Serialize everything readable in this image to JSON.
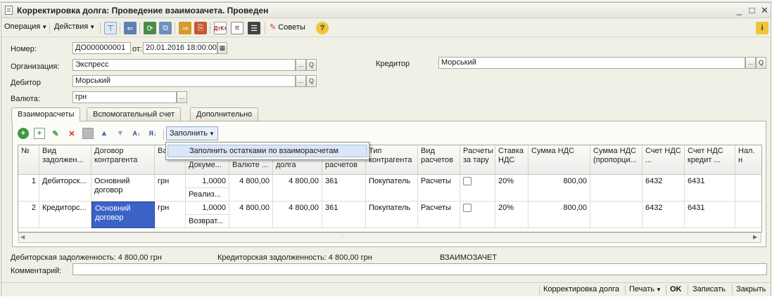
{
  "window": {
    "title": "Корректировка долга: Проведение взаимозачета. Проведен",
    "minimize": "_",
    "maximize": "□",
    "close": "✕"
  },
  "menu": {
    "operation": "Операция",
    "actions": "Действия",
    "tips": "Советы",
    "help": "?"
  },
  "form": {
    "number_label": "Номер:",
    "number_value": "ДО000000001",
    "date_label": "от:",
    "date_value": "20.01.2016 18:00:00",
    "org_label": "Организация:",
    "org_value": "Экспресс",
    "debtor_label": "Дебитор",
    "debtor_value": "Морський",
    "creditor_label": "Кредитор",
    "creditor_value": "Морський",
    "currency_label": "Валюта:",
    "currency_value": "грн",
    "select_btn": "...",
    "search_btn": "Q"
  },
  "tabs": [
    "Взаиморасчеты",
    "Вспомогательный счет",
    "Дополнительно"
  ],
  "table_toolbar": {
    "fill_button": "Заполнить",
    "dropdown_item": "Заполнить остатками по взаиморасчетам"
  },
  "table": {
    "headers": [
      "№",
      "Вид задолжен...",
      "Договор контрагента",
      "Ва",
      "Докуме...",
      "Валюте ...",
      "долга",
      "расчетов",
      "Тип контрагента",
      "Вид расчетов",
      "Расчеты за тару",
      "Ставка НДС",
      "Сумма НДС",
      "Сумма НДС (пропорци...",
      "Счет НДС ...",
      "Счет НДС кредит ...",
      "Нал. н"
    ],
    "rows": [
      {
        "num": "1",
        "kind": "Дебиторск...",
        "contract": "Основний договор",
        "currency": "грн",
        "rate": "1,0000",
        "doc": "Реализ...",
        "amount_cur": "4 800,00",
        "amount": "4 800,00",
        "account": "361",
        "ctype": "Покупатель",
        "calc": "Расчеты",
        "vat_rate": "20%",
        "vat_sum": "800,00",
        "vat_acc": "6432",
        "vat_acc_cr": "6431"
      },
      {
        "num": "2",
        "kind": "Кредиторс...",
        "contract": "Основний договор",
        "currency": "грн",
        "rate": "1,0000",
        "doc": "Возврат...",
        "amount_cur": "4 800,00",
        "amount": "4 800,00",
        "account": "361",
        "ctype": "Покупатель",
        "calc": "Расчеты",
        "vat_rate": "20%",
        "vat_sum": "800,00",
        "vat_acc": "6432",
        "vat_acc_cr": "6431"
      }
    ]
  },
  "footer": {
    "debtor_debt": "Дебиторская задолженность: 4 800,00 грн",
    "creditor_debt": "Кредиторская задолженность: 4 800,00 грн",
    "operation_type": "ВЗАИМОЗАЧЕТ",
    "comment_label": "Комментарий:",
    "comment_value": ""
  },
  "statusbar": {
    "doc": "Корректировка долга",
    "print": "Печать",
    "ok": "OK",
    "save": "Записать",
    "close": "Закрыть"
  }
}
